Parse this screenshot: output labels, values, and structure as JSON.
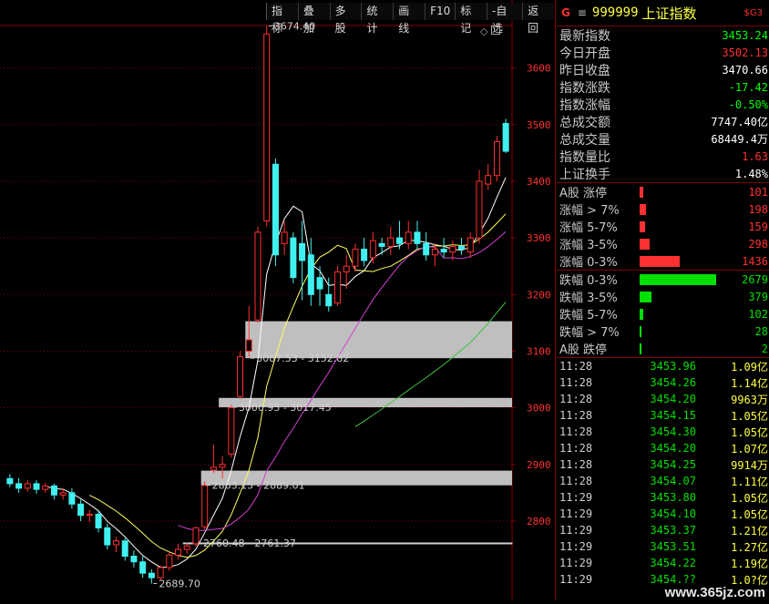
{
  "toolbar": {
    "items": [
      "指标",
      "叠加",
      "多股",
      "统计",
      "画线",
      "F10",
      "标记",
      "-自选",
      "返回"
    ]
  },
  "header": {
    "g": "G",
    "menu": "≡",
    "code": "999999",
    "name": "上证指数",
    "badge": "$G3"
  },
  "quote": [
    {
      "label": "最新指数",
      "value": "3453.24",
      "color": "#00ff00"
    },
    {
      "label": "今日开盘",
      "value": "3502.13",
      "color": "#ff3030"
    },
    {
      "label": "昨日收盘",
      "value": "3470.66",
      "color": "#ffffff"
    },
    {
      "label": "指数涨跌",
      "value": "-17.42",
      "color": "#00ff00"
    },
    {
      "label": "指数涨幅",
      "value": "-0.50%",
      "color": "#00ff00"
    },
    {
      "label": "总成交额",
      "value": "7747.40亿",
      "color": "#ffffff"
    },
    {
      "label": "总成交量",
      "value": "68449.4万",
      "color": "#ffffff"
    },
    {
      "label": "指数量比",
      "value": "1.63",
      "color": "#ff3030"
    },
    {
      "label": "上证换手",
      "value": "1.48%",
      "color": "#ffffff"
    }
  ],
  "breadth": [
    {
      "label": "A股 涨停",
      "value": "101",
      "level": 0.05,
      "color": "#ff3030"
    },
    {
      "label": "涨幅 > 7%",
      "value": "198",
      "level": 0.08,
      "color": "#ff3030"
    },
    {
      "label": "涨幅 5-7%",
      "value": "159",
      "level": 0.07,
      "color": "#ff3030"
    },
    {
      "label": "涨幅 3-5%",
      "value": "298",
      "level": 0.13,
      "color": "#ff3030"
    },
    {
      "label": "涨幅 0-3%",
      "value": "1436",
      "level": 0.52,
      "color": "#ff3030"
    },
    {
      "label": "跌幅 0-3%",
      "value": "2679",
      "level": 1.0,
      "color": "#00e000"
    },
    {
      "label": "跌幅 3-5%",
      "value": "379",
      "level": 0.15,
      "color": "#00e000"
    },
    {
      "label": "跌幅 5-7%",
      "value": "102",
      "level": 0.05,
      "color": "#00e000"
    },
    {
      "label": "跌幅 > 7%",
      "value": "28",
      "level": 0.01,
      "color": "#00e000"
    },
    {
      "label": "A股 跌停",
      "value": "2",
      "level": 0.01,
      "color": "#00e000"
    }
  ],
  "ticks": [
    {
      "time": "11:28",
      "price": "3453.96",
      "vol": "1.09亿"
    },
    {
      "time": "11:28",
      "price": "3454.26",
      "vol": "1.14亿"
    },
    {
      "time": "11:28",
      "price": "3454.20",
      "vol": "9963万"
    },
    {
      "time": "11:28",
      "price": "3454.15",
      "vol": "1.05亿"
    },
    {
      "time": "11:28",
      "price": "3454.30",
      "vol": "1.05亿"
    },
    {
      "time": "11:28",
      "price": "3454.20",
      "vol": "1.07亿"
    },
    {
      "time": "11:28",
      "price": "3454.25",
      "vol": "9914万"
    },
    {
      "time": "11:28",
      "price": "3454.07",
      "vol": "1.11亿"
    },
    {
      "time": "11:29",
      "price": "3453.80",
      "vol": "1.05亿"
    },
    {
      "time": "11:29",
      "price": "3454.10",
      "vol": "1.05亿"
    },
    {
      "time": "11:29",
      "price": "3453.37",
      "vol": "1.21亿"
    },
    {
      "time": "11:29",
      "price": "3453.51",
      "vol": "1.27亿"
    },
    {
      "time": "11:29",
      "price": "3454.22",
      "vol": "1.19亿"
    },
    {
      "time": "11:29",
      "price": "3454.??",
      "vol": "1.0?亿"
    }
  ],
  "chart_data": {
    "type": "candlestick",
    "ylim": [
      2660,
      3720
    ],
    "yticks": [
      2800,
      2900,
      3000,
      3100,
      3200,
      3300,
      3400,
      3500,
      3600
    ],
    "grid": true,
    "annotations": [
      {
        "text": "3674.40",
        "price": 3674.4
      },
      {
        "text": "2689.70",
        "price": 2689.7
      },
      {
        "text": "2760.48 - 2761.37",
        "price": 2761.37
      },
      {
        "text": "2863.15 - 2889.01",
        "price": 2863.15
      },
      {
        "text": "3000.95 - 3017.45",
        "price": 3000.95
      },
      {
        "text": "3087.53 - 3152.82",
        "price": 3087.53
      }
    ],
    "gaps": [
      [
        2760.48,
        2761.37
      ],
      [
        2863.15,
        2889.01
      ],
      [
        3000.95,
        3017.45
      ],
      [
        3087.53,
        3152.82
      ]
    ],
    "candles": [
      {
        "o": 2875,
        "h": 2883,
        "l": 2860,
        "c": 2866
      },
      {
        "o": 2866,
        "h": 2876,
        "l": 2850,
        "c": 2858
      },
      {
        "o": 2858,
        "h": 2872,
        "l": 2852,
        "c": 2866
      },
      {
        "o": 2866,
        "h": 2872,
        "l": 2848,
        "c": 2856
      },
      {
        "o": 2856,
        "h": 2868,
        "l": 2850,
        "c": 2862
      },
      {
        "o": 2862,
        "h": 2866,
        "l": 2838,
        "c": 2846
      },
      {
        "o": 2846,
        "h": 2858,
        "l": 2838,
        "c": 2850
      },
      {
        "o": 2850,
        "h": 2858,
        "l": 2822,
        "c": 2830
      },
      {
        "o": 2830,
        "h": 2838,
        "l": 2800,
        "c": 2810
      },
      {
        "o": 2810,
        "h": 2820,
        "l": 2798,
        "c": 2812
      },
      {
        "o": 2812,
        "h": 2818,
        "l": 2780,
        "c": 2788
      },
      {
        "o": 2788,
        "h": 2796,
        "l": 2750,
        "c": 2758
      },
      {
        "o": 2758,
        "h": 2772,
        "l": 2745,
        "c": 2765
      },
      {
        "o": 2765,
        "h": 2770,
        "l": 2730,
        "c": 2738
      },
      {
        "o": 2738,
        "h": 2748,
        "l": 2718,
        "c": 2728
      },
      {
        "o": 2728,
        "h": 2738,
        "l": 2700,
        "c": 2708
      },
      {
        "o": 2708,
        "h": 2715,
        "l": 2689.7,
        "c": 2700
      },
      {
        "o": 2700,
        "h": 2722,
        "l": 2696,
        "c": 2718
      },
      {
        "o": 2718,
        "h": 2745,
        "l": 2712,
        "c": 2740
      },
      {
        "o": 2740,
        "h": 2760,
        "l": 2732,
        "c": 2750
      },
      {
        "o": 2750,
        "h": 2761,
        "l": 2742,
        "c": 2756
      },
      {
        "o": 2760,
        "h": 2790,
        "l": 2755,
        "c": 2788
      },
      {
        "o": 2790,
        "h": 2870,
        "l": 2785,
        "c": 2863
      },
      {
        "o": 2890,
        "h": 2935,
        "l": 2885,
        "c": 2895
      },
      {
        "o": 2895,
        "h": 2915,
        "l": 2875,
        "c": 2900
      },
      {
        "o": 2918,
        "h": 3005,
        "l": 2912,
        "c": 3000
      },
      {
        "o": 3020,
        "h": 3100,
        "l": 3016,
        "c": 3090
      },
      {
        "o": 3100,
        "h": 3180,
        "l": 3090,
        "c": 3120
      },
      {
        "o": 3155,
        "h": 3320,
        "l": 3150,
        "c": 3310
      },
      {
        "o": 3330,
        "h": 3674.4,
        "l": 3320,
        "c": 3660
      },
      {
        "o": 3430,
        "h": 3440,
        "l": 3250,
        "c": 3270
      },
      {
        "o": 3290,
        "h": 3330,
        "l": 3270,
        "c": 3310
      },
      {
        "o": 3300,
        "h": 3310,
        "l": 3220,
        "c": 3230
      },
      {
        "o": 3290,
        "h": 3330,
        "l": 3190,
        "c": 3260
      },
      {
        "o": 3270,
        "h": 3300,
        "l": 3180,
        "c": 3200
      },
      {
        "o": 3230,
        "h": 3250,
        "l": 3180,
        "c": 3210
      },
      {
        "o": 3200,
        "h": 3230,
        "l": 3170,
        "c": 3180
      },
      {
        "o": 3185,
        "h": 3250,
        "l": 3180,
        "c": 3240
      },
      {
        "o": 3240,
        "h": 3270,
        "l": 3210,
        "c": 3250
      },
      {
        "o": 3250,
        "h": 3290,
        "l": 3240,
        "c": 3280
      },
      {
        "o": 3280,
        "h": 3300,
        "l": 3250,
        "c": 3260
      },
      {
        "o": 3265,
        "h": 3310,
        "l": 3255,
        "c": 3295
      },
      {
        "o": 3290,
        "h": 3300,
        "l": 3270,
        "c": 3285
      },
      {
        "o": 3285,
        "h": 3320,
        "l": 3270,
        "c": 3300
      },
      {
        "o": 3300,
        "h": 3330,
        "l": 3280,
        "c": 3290
      },
      {
        "o": 3290,
        "h": 3330,
        "l": 3280,
        "c": 3310
      },
      {
        "o": 3310,
        "h": 3330,
        "l": 3280,
        "c": 3290
      },
      {
        "o": 3290,
        "h": 3310,
        "l": 3260,
        "c": 3270
      },
      {
        "o": 3270,
        "h": 3290,
        "l": 3250,
        "c": 3280
      },
      {
        "o": 3280,
        "h": 3300,
        "l": 3265,
        "c": 3275
      },
      {
        "o": 3275,
        "h": 3295,
        "l": 3260,
        "c": 3285
      },
      {
        "o": 3285,
        "h": 3300,
        "l": 3270,
        "c": 3280
      },
      {
        "o": 3275,
        "h": 3310,
        "l": 3265,
        "c": 3300
      },
      {
        "o": 3300,
        "h": 3420,
        "l": 3290,
        "c": 3400
      },
      {
        "o": 3395,
        "h": 3430,
        "l": 3385,
        "c": 3410
      },
      {
        "o": 3410,
        "h": 3480,
        "l": 3400,
        "c": 3470
      },
      {
        "o": 3502,
        "h": 3510,
        "l": 3450,
        "c": 3453
      }
    ]
  }
}
